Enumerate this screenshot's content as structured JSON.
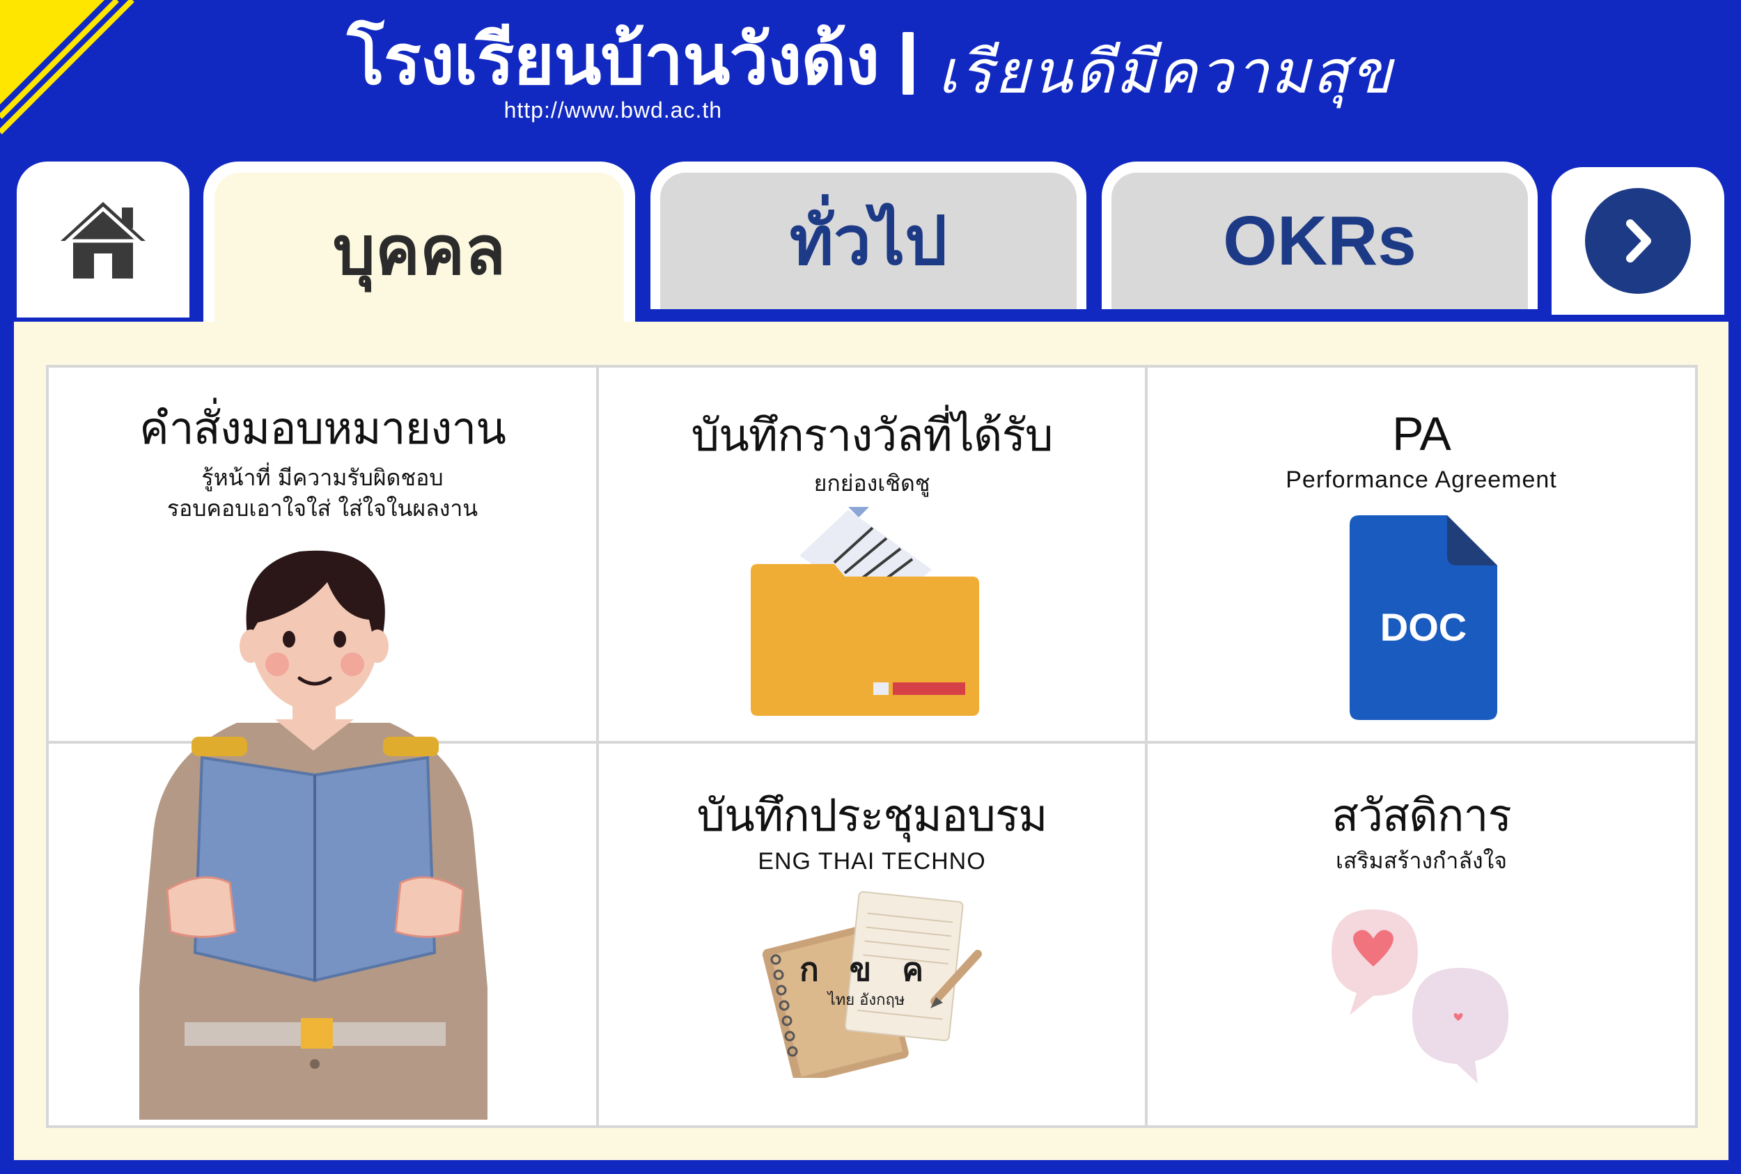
{
  "header": {
    "school_name": "โรงเรียนบ้านวังด้ง",
    "url": "http://www.bwd.ac.th",
    "motto": "เรียนดีมีความสุข",
    "colors": {
      "background": "#1129c1",
      "stripe": "#ffe600"
    }
  },
  "tabs": {
    "home": {
      "icon": "home-icon"
    },
    "items": [
      {
        "label": "บุคคล",
        "active": true
      },
      {
        "label": "ทั่วไป",
        "active": false
      },
      {
        "label": "OKRs",
        "active": false
      }
    ],
    "next": {
      "icon": "chevron-right-icon"
    }
  },
  "cards": {
    "assignment": {
      "title": "คำสั่งมอบหมายงาน",
      "subtitle_line1": "รู้หน้าที่ มีความรับผิดชอบ",
      "subtitle_line2": "รอบคอบเอาใจใส่ ใส่ใจในผลงาน",
      "image": "teacher-reading-illustration"
    },
    "awards": {
      "title": "บันทึกรางวัลที่ได้รับ",
      "subtitle": "ยกย่องเชิดชู",
      "icon": "folder-icon"
    },
    "pa": {
      "title": "PA",
      "subtitle": "Performance Agreement",
      "icon": "doc-file-icon",
      "icon_label": "DOC"
    },
    "training": {
      "title": "บันทึกประชุมอบรม",
      "subtitle": "ENG THAI TECHNO",
      "icon": "notebook-icon",
      "notebook_letters": "ก ข ค",
      "notebook_caption": "ไทย อังกฤษ"
    },
    "welfare": {
      "title": "สวัสดิการ",
      "subtitle": "เสริมสร้างกำลังใจ",
      "icon": "heart-chat-bubbles-icon"
    }
  }
}
